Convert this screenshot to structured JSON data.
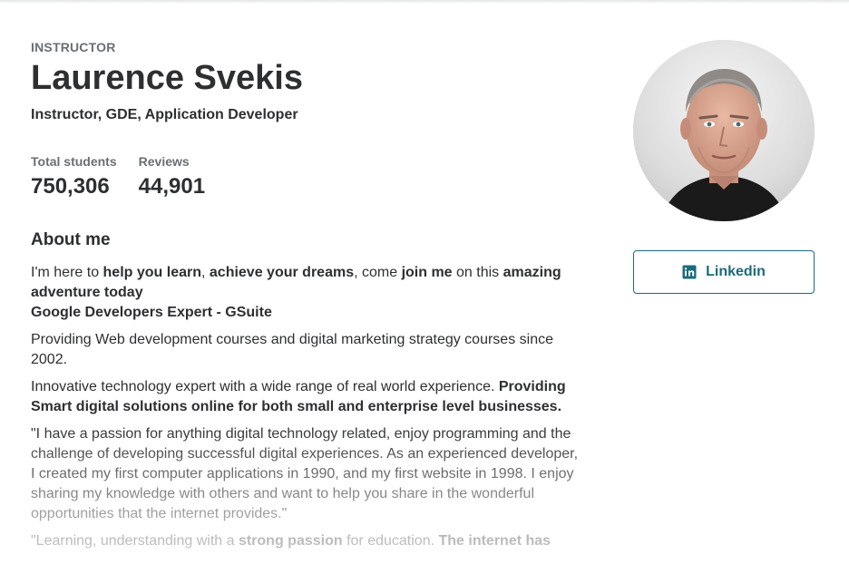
{
  "instructor": {
    "eyebrow": "INSTRUCTOR",
    "name": "Laurence Svekis",
    "headline": "Instructor, GDE, Application Developer"
  },
  "stats": [
    {
      "label": "Total students",
      "value": "750,306"
    },
    {
      "label": "Reviews",
      "value": "44,901"
    }
  ],
  "about": {
    "heading": "About me",
    "p1": {
      "t1": "I'm here to ",
      "b1": "help you learn",
      "t2": ", ",
      "b2": "achieve your dreams",
      "t3": ", come ",
      "b3": "join me",
      "t4": " on this ",
      "b4": "amazing adventure today",
      "b5": "Google Developers Expert - GSuite"
    },
    "p2": "Providing Web development courses and digital marketing strategy courses since 2002.",
    "p3": {
      "t1": "Innovative technology expert with a wide range of real world experience. ",
      "b1": "Providing Smart digital solutions online for both small and enterprise level businesses."
    },
    "p4": "\"I have a passion for anything digital technology related, enjoy programming and the challenge of developing successful digital experiences. As an experienced developer, I created my first computer applications in 1990, and my first website in 1998.  I enjoy sharing my knowledge with others and want to help you share in the wonderful opportunities that the internet provides.\"",
    "p5": {
      "t1": "\"Learning, understanding with a ",
      "b1": "strong passion",
      "t2": " for education.  ",
      "b2": "The internet has"
    }
  },
  "social": {
    "linkedin_label": "Linkedin",
    "linkedin_icon": "linkedin-icon"
  },
  "colors": {
    "accent": "#1c6b7a",
    "text": "#2d2f31",
    "muted": "#6a6f73"
  }
}
